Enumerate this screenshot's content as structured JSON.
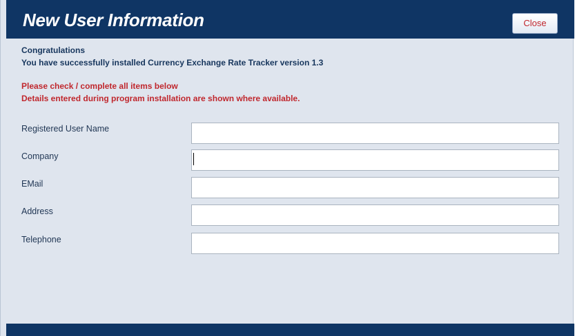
{
  "window": {
    "title": "New User Information",
    "close_label": "Close"
  },
  "messages": {
    "congrats_heading": "Congratulations",
    "install_line": "You have successfully installed Currency Exchange Rate Tracker version 1.3",
    "check_line": "Please check / complete all items below",
    "details_line": "Details entered during program installation are shown where available."
  },
  "fields": [
    {
      "label": "Registered User Name",
      "value": ""
    },
    {
      "label": "Company",
      "value": ""
    },
    {
      "label": "EMail",
      "value": ""
    },
    {
      "label": "Address",
      "value": ""
    },
    {
      "label": "Telephone",
      "value": ""
    }
  ],
  "colors": {
    "header_bg": "#0f3564",
    "body_bg": "#dfe5ee",
    "heading_text": "#17365d",
    "warning_text": "#c0272d"
  }
}
